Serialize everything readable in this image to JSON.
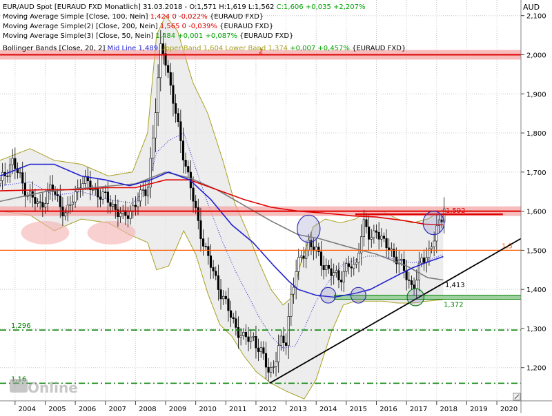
{
  "legend": {
    "l1_title": "EUR/AUD Spot [EURAUD FXD  Monatlich] 31.03.2018 - ",
    "l1_ohlc": "O:1,571 H:1,619 L:1,562 ",
    "l1_close": "C:1,606 +0,035 +2,207%",
    "l2_name": "Moving Average Simple [Close, 100, Nein] ",
    "l2_val": "1,424 0 -0,022%",
    "l2_sym": " {EURAUD FXD}",
    "l3_name": "Moving Average Simple(2) [Close, 200, Nein] ",
    "l3_val": "1,565 0 -0,039%",
    "l3_sym": " {EURAUD FXD}",
    "l4_name": "Moving Average Simple(3) [Close, 50, Nein] ",
    "l4_val": "1,484 +0,001 +0,087%",
    "l4_sym": " {EURAUD FXD}",
    "l5_name": "Bollinger Bands [Close, 20, 2] ",
    "l5_mid": "Mid Line 1,489 ",
    "l5_upper": "Upper Band 1,604 ",
    "l5_lower": "Lower Band 1,374 ",
    "l5_chg": "+0,007 +0,457%",
    "l5_sym": " {EURAUD FXD}"
  },
  "colors": {
    "background": "#ffffff",
    "grid": "#c8c8c8",
    "candle_up": "#ffffff",
    "candle_down": "#000000",
    "ma100": "#7a7a7a",
    "ma200": "#e00000",
    "ma50": "#1f1fd0",
    "bollinger": "#a8a020",
    "bollinger_fill": "#e6e6e6",
    "resistance": "#e00000",
    "resistance_band": "#f4a0a0",
    "support": "#008000",
    "orange": "#ff5a00",
    "trendline": "#000000"
  },
  "logo": "Online",
  "chart_data": {
    "type": "candlestick",
    "title": "EUR/AUD Spot [EURAUD FXD  Monatlich]",
    "ylabel": "AUD",
    "xlim": [
      2003.5,
      2020.8
    ],
    "ylim": [
      1.115,
      2.14
    ],
    "grid": true,
    "legend_position": "top-left",
    "x_ticks": [
      {
        "x": 2004.4,
        "label": "2004"
      },
      {
        "x": 2005.4,
        "label": "2005"
      },
      {
        "x": 2006.4,
        "label": "2006"
      },
      {
        "x": 2007.4,
        "label": "2007"
      },
      {
        "x": 2008.4,
        "label": "2008"
      },
      {
        "x": 2009.4,
        "label": "2009"
      },
      {
        "x": 2010.4,
        "label": "2010"
      },
      {
        "x": 2011.4,
        "label": "2011"
      },
      {
        "x": 2012.4,
        "label": "2012"
      },
      {
        "x": 2013.4,
        "label": "2013"
      },
      {
        "x": 2014.4,
        "label": "2014"
      },
      {
        "x": 2015.4,
        "label": "2015"
      },
      {
        "x": 2016.4,
        "label": "2016"
      },
      {
        "x": 2017.4,
        "label": "2017"
      },
      {
        "x": 2018.4,
        "label": "2018"
      },
      {
        "x": 2019.4,
        "label": "2019"
      },
      {
        "x": 2020.4,
        "label": "2020"
      }
    ],
    "y_ticks": [
      {
        "y": 2.1,
        "label": "2,100"
      },
      {
        "y": 2.0,
        "label": "2,000"
      },
      {
        "y": 1.9,
        "label": "1,900"
      },
      {
        "y": 1.8,
        "label": "1,800"
      },
      {
        "y": 1.7,
        "label": "1,700"
      },
      {
        "y": 1.6,
        "label": "1,600"
      },
      {
        "y": 1.5,
        "label": "1,500"
      },
      {
        "y": 1.4,
        "label": "1,400"
      },
      {
        "y": 1.3,
        "label": "1,300"
      },
      {
        "y": 1.2,
        "label": "1,200"
      }
    ],
    "price_path": [
      [
        2003.5,
        1.67
      ],
      [
        2003.9,
        1.73
      ],
      [
        2004.3,
        1.66
      ],
      [
        2004.8,
        1.61
      ],
      [
        2005.2,
        1.66
      ],
      [
        2005.7,
        1.59
      ],
      [
        2006.2,
        1.68
      ],
      [
        2006.7,
        1.65
      ],
      [
        2007.2,
        1.62
      ],
      [
        2007.6,
        1.58
      ],
      [
        2008.0,
        1.62
      ],
      [
        2008.4,
        1.66
      ],
      [
        2008.6,
        1.8
      ],
      [
        2008.75,
        1.93
      ],
      [
        2008.85,
        2.03
      ],
      [
        2009.0,
        1.99
      ],
      [
        2009.2,
        1.9
      ],
      [
        2009.45,
        1.8
      ],
      [
        2009.8,
        1.67
      ],
      [
        2010.05,
        1.58
      ],
      [
        2010.4,
        1.48
      ],
      [
        2010.7,
        1.42
      ],
      [
        2011.0,
        1.36
      ],
      [
        2011.3,
        1.31
      ],
      [
        2011.6,
        1.27
      ],
      [
        2011.9,
        1.28
      ],
      [
        2012.2,
        1.23
      ],
      [
        2012.45,
        1.19
      ],
      [
        2012.6,
        1.21
      ],
      [
        2012.8,
        1.26
      ],
      [
        2013.0,
        1.27
      ],
      [
        2013.15,
        1.38
      ],
      [
        2013.35,
        1.45
      ],
      [
        2013.55,
        1.49
      ],
      [
        2013.75,
        1.52
      ],
      [
        2013.95,
        1.5
      ],
      [
        2014.2,
        1.47
      ],
      [
        2014.5,
        1.44
      ],
      [
        2014.75,
        1.43
      ],
      [
        2015.05,
        1.46
      ],
      [
        2015.3,
        1.45
      ],
      [
        2015.45,
        1.53
      ],
      [
        2015.6,
        1.57
      ],
      [
        2015.8,
        1.52
      ],
      [
        2016.0,
        1.56
      ],
      [
        2016.2,
        1.52
      ],
      [
        2016.45,
        1.5
      ],
      [
        2016.7,
        1.48
      ],
      [
        2016.95,
        1.44
      ],
      [
        2017.15,
        1.41
      ],
      [
        2017.3,
        1.42
      ],
      [
        2017.5,
        1.47
      ],
      [
        2017.7,
        1.49
      ],
      [
        2017.85,
        1.52
      ],
      [
        2018.0,
        1.55
      ],
      [
        2018.15,
        1.57
      ],
      [
        2018.22,
        1.606
      ]
    ],
    "series": [
      {
        "name": "Moving Average Simple [Close, 100, Nein]",
        "color": "#7a7a7a",
        "points": [
          [
            2003.5,
            1.625
          ],
          [
            2005.0,
            1.65
          ],
          [
            2006.5,
            1.66
          ],
          [
            2008.0,
            1.67
          ],
          [
            2009.0,
            1.7
          ],
          [
            2009.8,
            1.685
          ],
          [
            2010.7,
            1.655
          ],
          [
            2011.6,
            1.615
          ],
          [
            2012.5,
            1.575
          ],
          [
            2013.4,
            1.54
          ],
          [
            2014.1,
            1.53
          ],
          [
            2015.0,
            1.51
          ],
          [
            2016.0,
            1.49
          ],
          [
            2017.0,
            1.46
          ],
          [
            2017.7,
            1.43
          ],
          [
            2018.22,
            1.424
          ]
        ]
      },
      {
        "name": "Moving Average Simple(2) [Close, 200, Nein]",
        "color": "#e00000",
        "points": [
          [
            2003.5,
            1.652
          ],
          [
            2005.0,
            1.655
          ],
          [
            2006.0,
            1.655
          ],
          [
            2007.0,
            1.66
          ],
          [
            2008.0,
            1.66
          ],
          [
            2009.0,
            1.68
          ],
          [
            2009.8,
            1.68
          ],
          [
            2010.7,
            1.655
          ],
          [
            2011.6,
            1.63
          ],
          [
            2012.5,
            1.61
          ],
          [
            2013.4,
            1.6
          ],
          [
            2014.3,
            1.595
          ],
          [
            2015.2,
            1.588
          ],
          [
            2016.0,
            1.585
          ],
          [
            2017.0,
            1.575
          ],
          [
            2017.6,
            1.567
          ],
          [
            2018.22,
            1.565
          ]
        ]
      },
      {
        "name": "Moving Average Simple(3) [Close, 50, Nein]",
        "color": "#1f1fd0",
        "points": [
          [
            2003.5,
            1.69
          ],
          [
            2004.5,
            1.72
          ],
          [
            2005.3,
            1.72
          ],
          [
            2006.2,
            1.69
          ],
          [
            2007.0,
            1.68
          ],
          [
            2007.8,
            1.665
          ],
          [
            2008.5,
            1.68
          ],
          [
            2009.1,
            1.7
          ],
          [
            2009.8,
            1.68
          ],
          [
            2010.5,
            1.63
          ],
          [
            2011.2,
            1.565
          ],
          [
            2011.9,
            1.52
          ],
          [
            2012.6,
            1.46
          ],
          [
            2013.1,
            1.42
          ],
          [
            2013.4,
            1.4
          ],
          [
            2014.0,
            1.385
          ],
          [
            2014.6,
            1.38
          ],
          [
            2015.3,
            1.39
          ],
          [
            2015.8,
            1.4
          ],
          [
            2016.3,
            1.42
          ],
          [
            2016.8,
            1.44
          ],
          [
            2017.2,
            1.455
          ],
          [
            2017.7,
            1.47
          ],
          [
            2018.22,
            1.484
          ]
        ]
      }
    ],
    "bollinger": {
      "name": "Bollinger Bands [Close, 20, 2]",
      "upper": [
        [
          2003.5,
          1.73
        ],
        [
          2004.5,
          1.76
        ],
        [
          2005.3,
          1.73
        ],
        [
          2006.2,
          1.72
        ],
        [
          2007.1,
          1.69
        ],
        [
          2007.9,
          1.7
        ],
        [
          2008.4,
          1.8
        ],
        [
          2008.7,
          2.05
        ],
        [
          2009.0,
          2.1
        ],
        [
          2009.4,
          2.06
        ],
        [
          2009.9,
          1.93
        ],
        [
          2010.4,
          1.85
        ],
        [
          2010.9,
          1.73
        ],
        [
          2011.3,
          1.62
        ],
        [
          2011.7,
          1.55
        ],
        [
          2012.1,
          1.47
        ],
        [
          2012.5,
          1.4
        ],
        [
          2012.9,
          1.36
        ],
        [
          2013.2,
          1.38
        ],
        [
          2013.5,
          1.47
        ],
        [
          2013.9,
          1.56
        ],
        [
          2014.3,
          1.58
        ],
        [
          2014.8,
          1.57
        ],
        [
          2015.3,
          1.58
        ],
        [
          2015.7,
          1.6
        ],
        [
          2016.2,
          1.6
        ],
        [
          2016.7,
          1.58
        ],
        [
          2017.2,
          1.57
        ],
        [
          2017.7,
          1.58
        ],
        [
          2018.22,
          1.604
        ]
      ],
      "lower": [
        [
          2003.5,
          1.6
        ],
        [
          2004.5,
          1.59
        ],
        [
          2005.3,
          1.55
        ],
        [
          2006.2,
          1.58
        ],
        [
          2007.1,
          1.57
        ],
        [
          2007.8,
          1.54
        ],
        [
          2008.4,
          1.52
        ],
        [
          2008.7,
          1.45
        ],
        [
          2009.1,
          1.46
        ],
        [
          2009.6,
          1.55
        ],
        [
          2010.0,
          1.49
        ],
        [
          2010.4,
          1.39
        ],
        [
          2010.8,
          1.31
        ],
        [
          2011.2,
          1.28
        ],
        [
          2011.6,
          1.23
        ],
        [
          2012.0,
          1.19
        ],
        [
          2012.5,
          1.16
        ],
        [
          2013.0,
          1.14
        ],
        [
          2013.3,
          1.13
        ],
        [
          2013.6,
          1.12
        ],
        [
          2014.0,
          1.17
        ],
        [
          2014.5,
          1.29
        ],
        [
          2014.9,
          1.36
        ],
        [
          2015.3,
          1.37
        ],
        [
          2015.7,
          1.37
        ],
        [
          2016.2,
          1.37
        ],
        [
          2016.7,
          1.365
        ],
        [
          2017.2,
          1.365
        ],
        [
          2017.7,
          1.37
        ],
        [
          2018.22,
          1.374
        ]
      ],
      "mid": [
        [
          2003.5,
          1.665
        ],
        [
          2004.5,
          1.675
        ],
        [
          2005.3,
          1.64
        ],
        [
          2006.2,
          1.65
        ],
        [
          2007.1,
          1.63
        ],
        [
          2007.9,
          1.62
        ],
        [
          2008.4,
          1.66
        ],
        [
          2008.7,
          1.75
        ],
        [
          2009.1,
          1.78
        ],
        [
          2009.6,
          1.8
        ],
        [
          2010.0,
          1.71
        ],
        [
          2010.4,
          1.62
        ],
        [
          2010.9,
          1.52
        ],
        [
          2011.3,
          1.45
        ],
        [
          2011.7,
          1.39
        ],
        [
          2012.1,
          1.33
        ],
        [
          2012.5,
          1.28
        ],
        [
          2012.9,
          1.25
        ],
        [
          2013.3,
          1.255
        ],
        [
          2013.6,
          1.3
        ],
        [
          2014.0,
          1.37
        ],
        [
          2014.5,
          1.43
        ],
        [
          2014.9,
          1.465
        ],
        [
          2015.3,
          1.475
        ],
        [
          2015.7,
          1.485
        ],
        [
          2016.2,
          1.485
        ],
        [
          2016.7,
          1.475
        ],
        [
          2017.2,
          1.468
        ],
        [
          2017.7,
          1.475
        ],
        [
          2018.22,
          1.489
        ]
      ]
    },
    "horizontal_lines": [
      {
        "y": 2.0,
        "label": "2",
        "style": "resistance_band",
        "color": "#e00000"
      },
      {
        "y": 1.6,
        "label": "",
        "style": "resistance_band",
        "color": "#e00000"
      },
      {
        "y": 1.592,
        "label": "1,592",
        "style": "segment",
        "x_from": 2015.3,
        "x_to": 2020.2,
        "color": "#e00000"
      },
      {
        "y": 1.5,
        "label": "1,5",
        "style": "solid",
        "color": "#ff5a00"
      },
      {
        "y": 1.413,
        "label": "1,413",
        "style": "text",
        "color": "#000000"
      },
      {
        "y": 1.38,
        "label": "1,372",
        "style": "support_band",
        "x_from": 2014.6,
        "color": "#008000"
      },
      {
        "y": 1.296,
        "label": "1,296",
        "style": "dashdot",
        "color": "#008000"
      },
      {
        "y": 1.16,
        "label": "1,16",
        "style": "dashdot",
        "color": "#008000"
      }
    ],
    "trendline": {
      "from": [
        2012.45,
        1.16
      ],
      "to": [
        2020.8,
        1.53
      ]
    },
    "annotations": [
      {
        "type": "ellipse",
        "cx": 2005.0,
        "cy": 1.545,
        "rx": 0.8,
        "ry": 0.03,
        "color": "#f5b0b0"
      },
      {
        "type": "ellipse",
        "cx": 2007.2,
        "cy": 1.545,
        "rx": 0.8,
        "ry": 0.03,
        "color": "#f5b0b0"
      },
      {
        "type": "circle",
        "cx": 2013.75,
        "cy": 1.555,
        "rx": 0.38,
        "ry": 0.035,
        "color": "#3030b0"
      },
      {
        "type": "circle",
        "cx": 2017.9,
        "cy": 1.57,
        "rx": 0.35,
        "ry": 0.03,
        "color": "#3030b0"
      },
      {
        "type": "circle",
        "cx": 2014.4,
        "cy": 1.385,
        "rx": 0.25,
        "ry": 0.02,
        "color": "#3030b0"
      },
      {
        "type": "circle",
        "cx": 2015.4,
        "cy": 1.385,
        "rx": 0.25,
        "ry": 0.02,
        "color": "#3030b0"
      },
      {
        "type": "circle",
        "cx": 2017.3,
        "cy": 1.38,
        "rx": 0.28,
        "ry": 0.022,
        "color": "#008000"
      }
    ]
  }
}
